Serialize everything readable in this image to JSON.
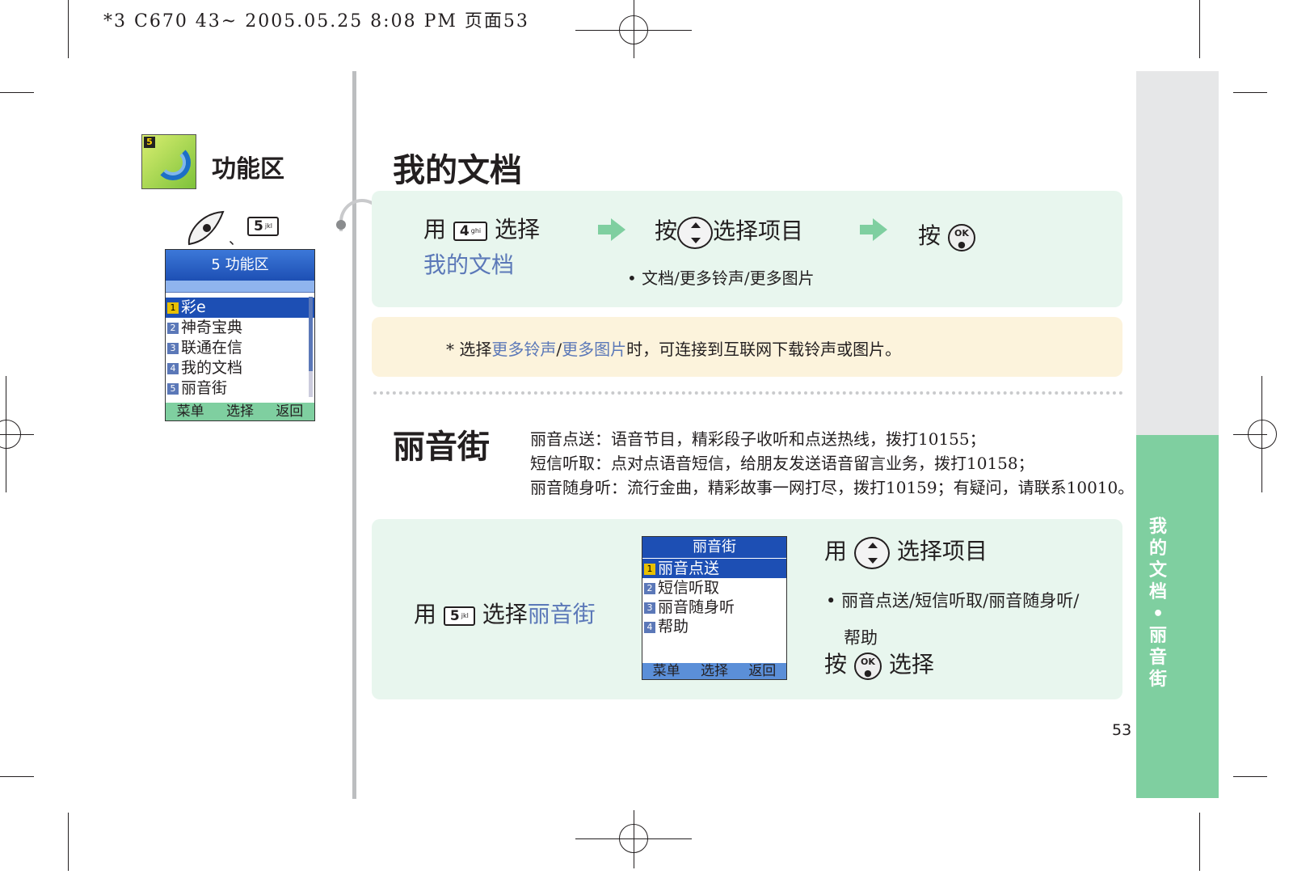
{
  "print_header": "*3 C670 43~ 2005.05.25 8:08 PM 页面53",
  "sidebar": {
    "section_title": "功能区",
    "section_icon": "function-zone-icon",
    "key_separator": "、",
    "key_5_label": "5",
    "key_5_sub": "jkl",
    "phone": {
      "title": "5 功能区",
      "items": [
        {
          "num": "1",
          "label": "彩e"
        },
        {
          "num": "2",
          "label": "神奇宝典"
        },
        {
          "num": "3",
          "label": "联通在信"
        },
        {
          "num": "4",
          "label": "我的文档"
        },
        {
          "num": "5",
          "label": "丽音街"
        }
      ],
      "softkeys": [
        "菜单",
        "选择",
        "返回"
      ]
    }
  },
  "my_docs": {
    "title": "我的文档",
    "step1_prefix": "用",
    "step1_key": "4",
    "step1_key_sub": "ghi",
    "step1_suffix": "选择",
    "step1_target": "我的文档",
    "step2_prefix": "按",
    "step2_suffix": "选择项目",
    "step2_bullet": "文档/更多铃声/更多图片",
    "step3_prefix": "按",
    "ok_label": "OK",
    "note_prefix": "* 选择",
    "note_link1": "更多铃声",
    "note_slash": "/",
    "note_link2": "更多图片",
    "note_suffix": "时，可连接到互联网下载铃声或图片。"
  },
  "liyinjie": {
    "title": "丽音街",
    "desc": [
      "丽音点送：语音节目，精彩段子收听和点送热线，拨打10155；",
      "短信听取：点对点语音短信，给朋友发送语音留言业务，拨打10158；",
      "丽音随身听：流行金曲，精彩故事一网打尽，拨打10159；有疑问，请联系10010。"
    ],
    "step1_prefix": "用",
    "step1_key": "5",
    "step1_key_sub": "jkl",
    "step1_suffix": "选择",
    "step1_target": "丽音街",
    "phone": {
      "title": "丽音街",
      "items": [
        {
          "num": "1",
          "label": "丽音点送"
        },
        {
          "num": "2",
          "label": "短信听取"
        },
        {
          "num": "3",
          "label": "丽音随身听"
        },
        {
          "num": "4",
          "label": "帮助"
        }
      ],
      "softkeys": [
        "菜单",
        "选择",
        "返回"
      ]
    },
    "step2_prefix": "用",
    "step2_suffix": "选择项目",
    "step2_bullet_line1": "丽音点送/短信听取/丽音随身听/",
    "step2_bullet_line2": "帮助",
    "step3_prefix": "按",
    "step3_suffix": "选择",
    "ok_label": "OK"
  },
  "side_tab": {
    "chars": [
      "我",
      "的",
      "文",
      "档",
      "•",
      "丽",
      "音",
      "街"
    ]
  },
  "page_number": "53",
  "colors": {
    "green_panel": "#e8f6ee",
    "cream_panel": "#fcf3dc",
    "tab_green": "#7fcfa0",
    "tab_grey": "#e6e7e8",
    "link_blue": "#5b78b8",
    "phone_title_blue": "#1d4fb4"
  }
}
